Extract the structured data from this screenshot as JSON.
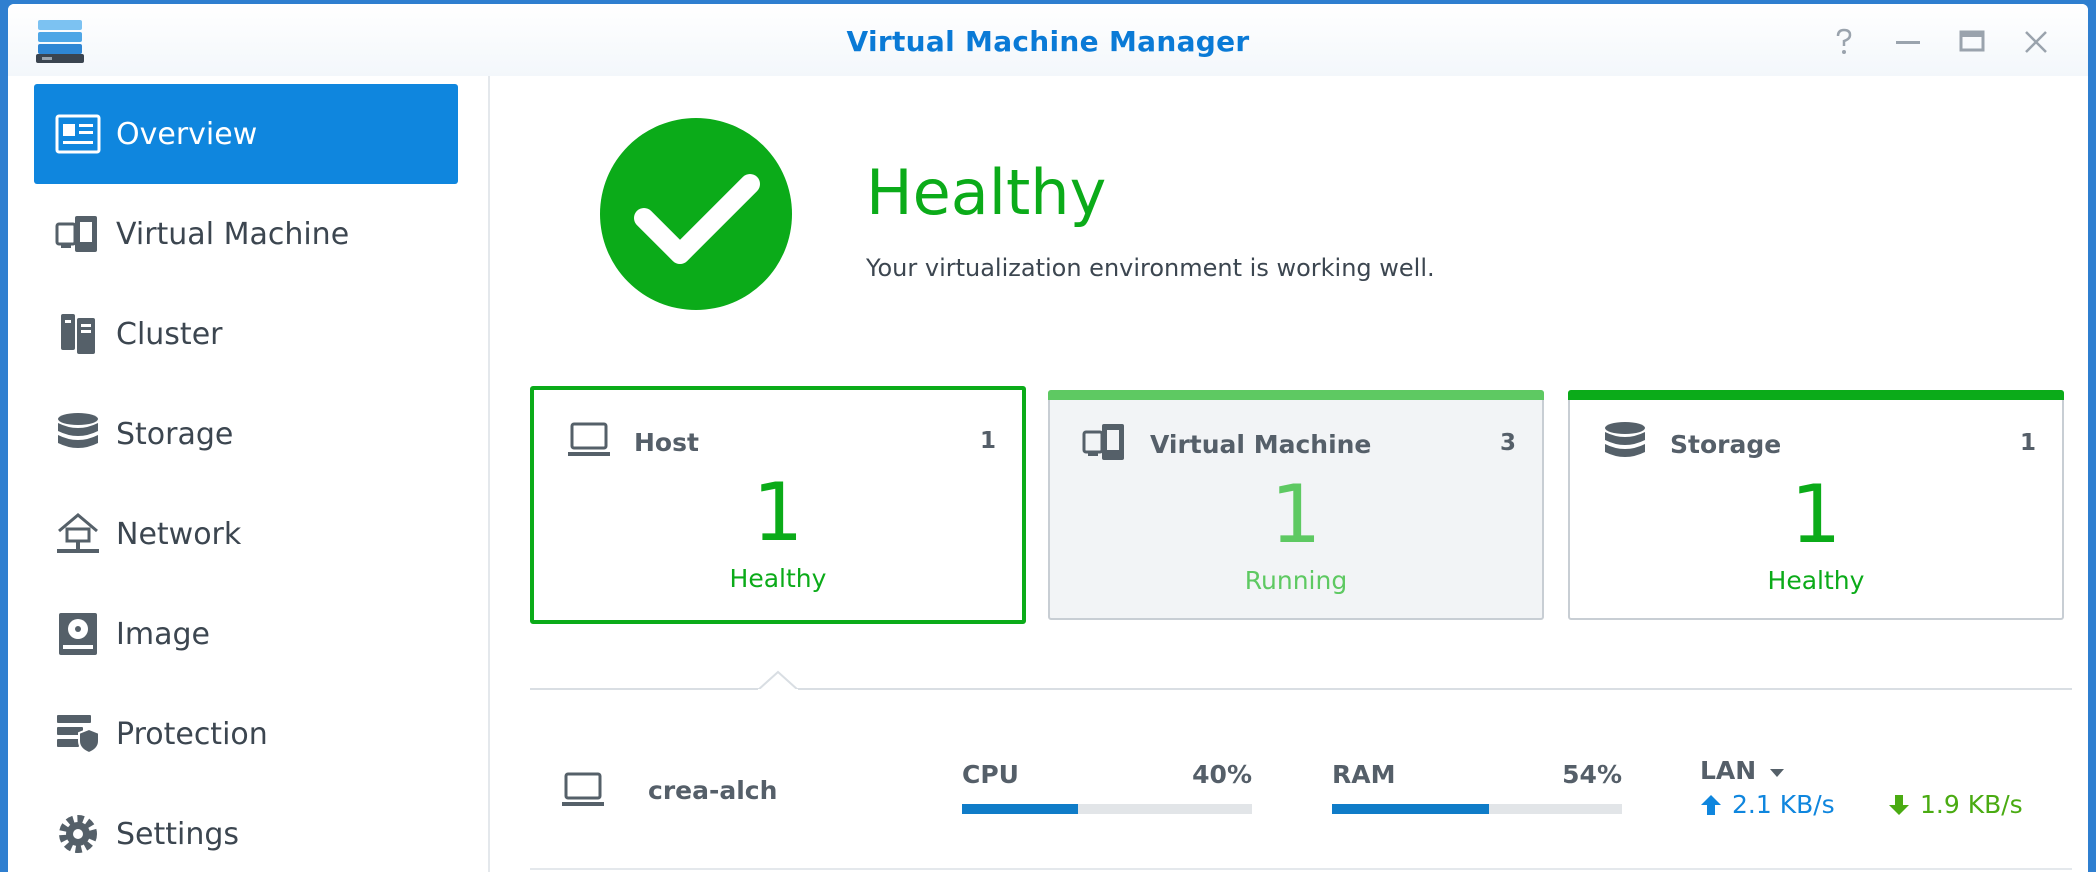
{
  "window": {
    "title": "Virtual Machine Manager"
  },
  "sidebar": {
    "items": [
      {
        "label": "Overview",
        "icon": "overview-icon",
        "active": true
      },
      {
        "label": "Virtual Machine",
        "icon": "virtual-machine-icon"
      },
      {
        "label": "Cluster",
        "icon": "cluster-icon"
      },
      {
        "label": "Storage",
        "icon": "storage-icon"
      },
      {
        "label": "Network",
        "icon": "network-icon"
      },
      {
        "label": "Image",
        "icon": "image-icon"
      },
      {
        "label": "Protection",
        "icon": "protection-icon"
      },
      {
        "label": "Settings",
        "icon": "settings-icon"
      }
    ]
  },
  "status": {
    "title": "Healthy",
    "subtitle": "Your virtualization environment is working well."
  },
  "cards": [
    {
      "title": "Host",
      "count": "1",
      "number": "1",
      "state": "Healthy"
    },
    {
      "title": "Virtual Machine",
      "count": "3",
      "number": "1",
      "state": "Running"
    },
    {
      "title": "Storage",
      "count": "1",
      "number": "1",
      "state": "Healthy"
    }
  ],
  "host": {
    "name": "crea-alch",
    "cpu": {
      "label": "CPU",
      "value": "40%",
      "fraction": 0.4
    },
    "ram": {
      "label": "RAM",
      "value": "54%",
      "fraction": 0.54
    },
    "lan": {
      "label": "LAN",
      "upload": "2.1 KB/s",
      "download": "1.9 KB/s"
    }
  },
  "colors": {
    "accent": "#0f86de",
    "healthy": "#0bab19",
    "running": "#5ec962",
    "upload": "#0f86de",
    "download": "#4aab12"
  }
}
